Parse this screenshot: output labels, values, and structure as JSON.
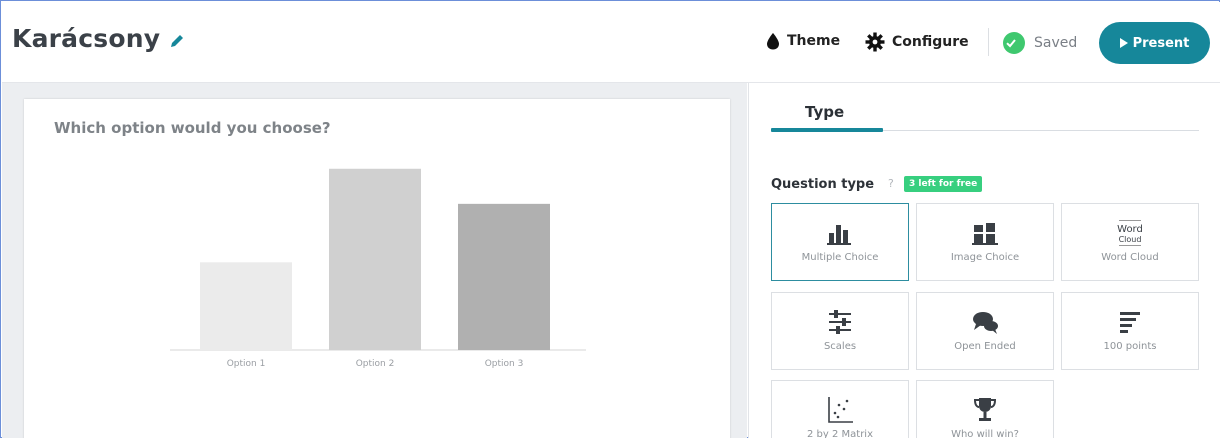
{
  "header": {
    "title": "Karácsony",
    "toolbar": {
      "theme_label": "Theme",
      "configure_label": "Configure",
      "saved_label": "Saved",
      "present_label": "Present"
    }
  },
  "slide": {
    "question": "Which option would you choose?"
  },
  "chart_data": {
    "type": "bar",
    "categories": [
      "Option 1",
      "Option 2",
      "Option 3"
    ],
    "values": [
      30,
      62,
      50
    ],
    "colors": [
      "#ebebeb",
      "#d0d0d0",
      "#b0b0b0"
    ],
    "ylim": [
      0,
      65
    ],
    "title": "",
    "xlabel": "",
    "ylabel": ""
  },
  "right_panel": {
    "tab_label": "Type",
    "question_type_label": "Question type",
    "help_mark": "?",
    "free_badge": "3 left for free",
    "types": [
      {
        "label": "Multiple Choice",
        "icon": "bar-chart-icon",
        "selected": true
      },
      {
        "label": "Image Choice",
        "icon": "image-choice-icon",
        "selected": false
      },
      {
        "label": "Word Cloud",
        "icon": "word-cloud-icon",
        "selected": false
      },
      {
        "label": "Scales",
        "icon": "sliders-icon",
        "selected": false
      },
      {
        "label": "Open Ended",
        "icon": "speech-bubbles-icon",
        "selected": false
      },
      {
        "label": "100 points",
        "icon": "horizontal-bars-icon",
        "selected": false
      },
      {
        "label": "2 by 2 Matrix",
        "icon": "scatter-plot-icon",
        "selected": false
      },
      {
        "label": "Who will win?",
        "icon": "trophy-icon",
        "selected": false
      }
    ]
  },
  "colors": {
    "accent": "#16879a",
    "saved_green": "#3fc86f",
    "badge_green": "#37cf7f"
  }
}
